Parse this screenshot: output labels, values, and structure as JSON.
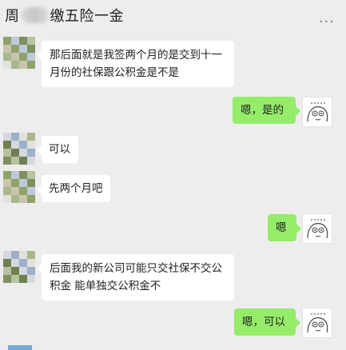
{
  "header": {
    "title_prefix": "周",
    "title_suffix": "缴五险一金",
    "menu_label": "..."
  },
  "messages": [
    {
      "side": "in",
      "text_lines": [
        "那后面就是我签两个月的是交到十一",
        "月份的社保跟公积金是不是"
      ]
    },
    {
      "side": "out",
      "text": "嗯，是的"
    },
    {
      "side": "in",
      "text": "可以"
    },
    {
      "side": "in",
      "text": "先两个月吧"
    },
    {
      "side": "out",
      "text": "嗯"
    },
    {
      "side": "in",
      "text_lines": [
        "后面我的新公司可能只交社保不交公",
        "积金  能单独交公积金不"
      ]
    },
    {
      "side": "out",
      "text": "嗯，可以"
    }
  ],
  "colors": {
    "background": "#ededed",
    "incoming_bubble": "#ffffff",
    "outgoing_bubble": "#95ec69"
  }
}
